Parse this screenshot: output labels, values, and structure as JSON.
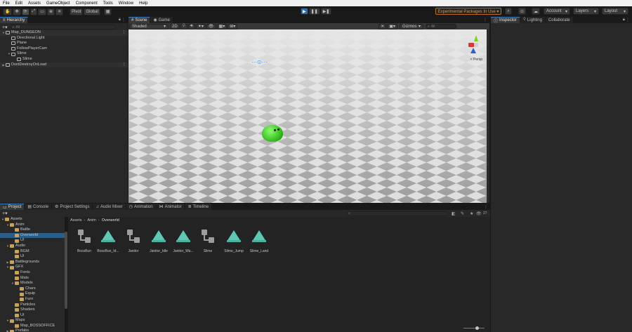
{
  "menu": [
    "File",
    "Edit",
    "Assets",
    "GameObject",
    "Component",
    "Tools",
    "Window",
    "Help"
  ],
  "toolbar": {
    "pivot": "Pivot",
    "global": "Global",
    "experimental": "Experimental Packages In Use ▾",
    "account": "Account",
    "layers": "Layers",
    "layout": "Layout"
  },
  "hierarchy": {
    "tab": "Hierarchy",
    "search_placeholder": "All",
    "items": [
      {
        "label": "Map_DUNGEON",
        "depth": 0,
        "expanded": true,
        "kind": "scene"
      },
      {
        "label": "Directional Light",
        "depth": 1,
        "kind": "object"
      },
      {
        "label": "Plane",
        "depth": 1,
        "kind": "object"
      },
      {
        "label": "FollowPlayerCam",
        "depth": 1,
        "kind": "object"
      },
      {
        "label": "Slime",
        "depth": 1,
        "expanded": true,
        "kind": "object"
      },
      {
        "label": "Slime",
        "depth": 2,
        "kind": "object"
      },
      {
        "label": "DontDestroyOnLoad",
        "depth": 0,
        "expanded": false,
        "kind": "scene"
      }
    ]
  },
  "scene": {
    "tabs": [
      "Scene",
      "Game"
    ],
    "shading": "Shaded",
    "mode2d": "2D",
    "gizmos": "Gizmos",
    "search_placeholder": "All",
    "persp": "< Persp"
  },
  "inspector": {
    "tabs": [
      "Inspector",
      "Lighting",
      "Collaborate"
    ]
  },
  "bottom": {
    "tabs": [
      "Project",
      "Console",
      "Project Settings",
      "Audio Mixer",
      "Animation",
      "Animator",
      "Timeline"
    ],
    "breadcrumb": [
      "Assets",
      "Anim",
      "Overworld"
    ],
    "badge": "27",
    "tree": [
      {
        "label": "Assets",
        "depth": 0,
        "expanded": true
      },
      {
        "label": "Anim",
        "depth": 1,
        "expanded": true
      },
      {
        "label": "Battle",
        "depth": 2
      },
      {
        "label": "Overworld",
        "depth": 2,
        "selected": true
      },
      {
        "label": "UI",
        "depth": 2
      },
      {
        "label": "Audio",
        "depth": 1,
        "expanded": true
      },
      {
        "label": "BGM",
        "depth": 2
      },
      {
        "label": "UI",
        "depth": 2
      },
      {
        "label": "Battlegrounds",
        "depth": 1
      },
      {
        "label": "GFX",
        "depth": 1,
        "expanded": true
      },
      {
        "label": "Fonts",
        "depth": 2
      },
      {
        "label": "Mats",
        "depth": 2
      },
      {
        "label": "Models",
        "depth": 2,
        "expanded": true
      },
      {
        "label": "Chars",
        "depth": 3
      },
      {
        "label": "Equip",
        "depth": 3
      },
      {
        "label": "Furn",
        "depth": 3
      },
      {
        "label": "Particles",
        "depth": 2
      },
      {
        "label": "Shaders",
        "depth": 2
      },
      {
        "label": "UI",
        "depth": 2
      },
      {
        "label": "Maps",
        "depth": 1,
        "expanded": true
      },
      {
        "label": "Map_BOSSOFFICE",
        "depth": 2
      },
      {
        "label": "Prefabs",
        "depth": 1
      }
    ],
    "assets": [
      {
        "label": "BossBun",
        "kind": "controller"
      },
      {
        "label": "BossBun_Id...",
        "kind": "clip"
      },
      {
        "label": "Janitor",
        "kind": "controller"
      },
      {
        "label": "Janitor_Idle",
        "kind": "clip"
      },
      {
        "label": "Janitor_Wa...",
        "kind": "clip"
      },
      {
        "label": "Slime",
        "kind": "controller"
      },
      {
        "label": "Slime_Jump",
        "kind": "clip"
      },
      {
        "label": "Slime_Land",
        "kind": "clip"
      }
    ]
  }
}
